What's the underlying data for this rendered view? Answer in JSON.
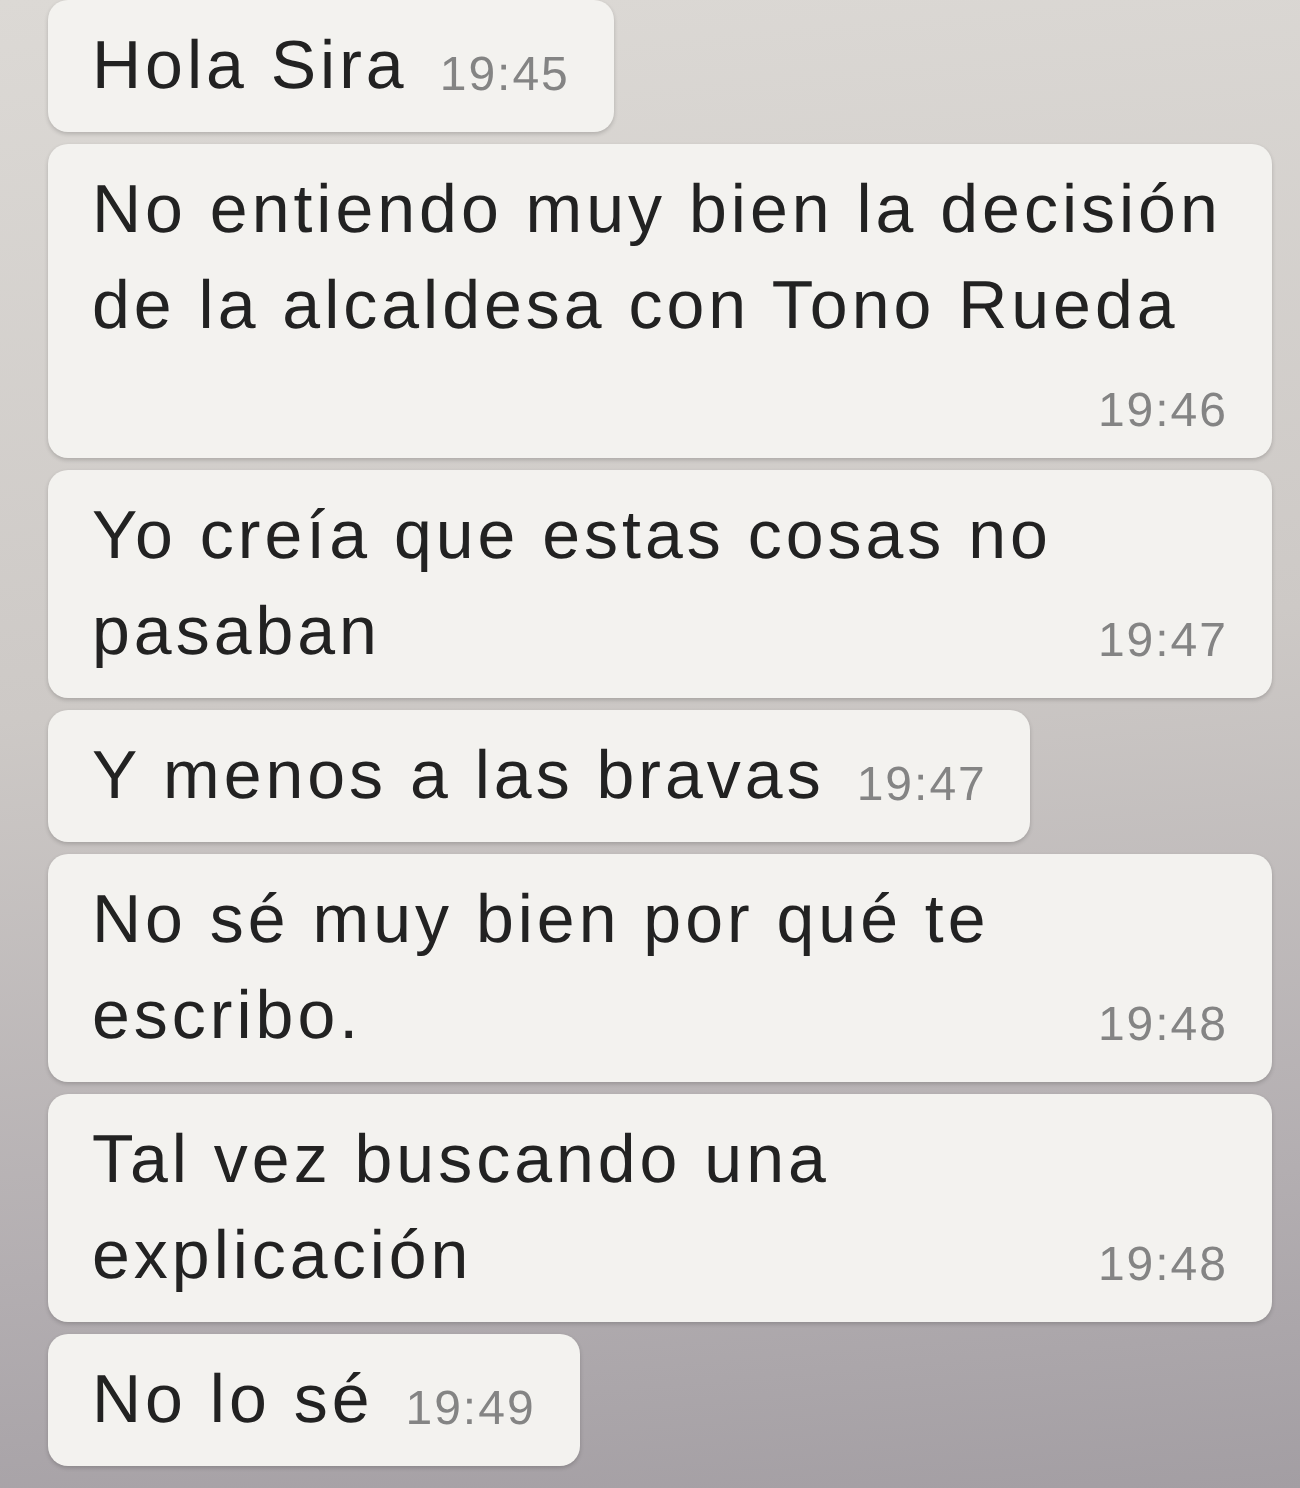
{
  "messages": [
    {
      "text": "Hola Sira",
      "time": "19:45"
    },
    {
      "text": "No entiendo muy bien la decisión de la alcaldesa con Tono Rueda",
      "time": "19:46"
    },
    {
      "text": "Yo creía que estas cosas no pasaban",
      "time": "19:47"
    },
    {
      "text": "Y menos a las bravas",
      "time": "19:47"
    },
    {
      "text": "No sé muy bien por qué te escribo.",
      "time": "19:48"
    },
    {
      "text": "Tal vez buscando una explicación",
      "time": "19:48"
    },
    {
      "text": "No lo sé",
      "time": "19:49"
    }
  ]
}
